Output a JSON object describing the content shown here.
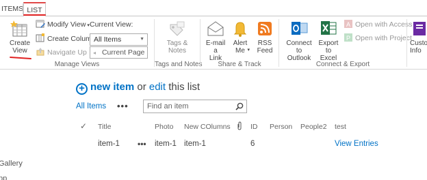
{
  "ribbon": {
    "tabs": {
      "items": "ITEMS",
      "list": "LIST"
    },
    "manage_views": {
      "create_view": "Create\nView",
      "modify_view": "Modify View",
      "create_column": "Create Column",
      "navigate_up": "Navigate Up",
      "current_view_label": "Current View:",
      "current_view_value": "All Items",
      "current_page": "Current Page",
      "group_label": "Manage Views"
    },
    "tags_notes": {
      "tags_notes": "Tags &\nNotes",
      "group_label": "Tags and Notes"
    },
    "share_track": {
      "email_link": "E-mail a\nLink",
      "alert_me": "Alert\nMe",
      "rss_feed": "RSS\nFeed",
      "group_label": "Share & Track"
    },
    "connect_export": {
      "connect_outlook": "Connect to\nOutlook",
      "export_excel": "Export to\nExcel",
      "open_access": "Open with Access",
      "open_project": "Open with Project",
      "group_label": "Connect & Export"
    },
    "customize": {
      "label": "Custo\nInfo"
    }
  },
  "page": {
    "new_item": "new item",
    "or": "or",
    "edit": "edit",
    "this_list": "this list",
    "all_items": "All Items",
    "more": "•••",
    "search_placeholder": "Find an item"
  },
  "table": {
    "check": "✓",
    "columns": [
      "Title",
      "Photo",
      "New COlumns",
      "ID",
      "Person",
      "People2",
      "test"
    ],
    "rows": [
      {
        "title": "item-1",
        "menu": "•••",
        "photo": "item-1",
        "new_columns": "item-1",
        "id": "6",
        "test": "View Entries"
      }
    ]
  },
  "left_nav": {
    "item1": "Gallery",
    "item2": "pp"
  },
  "colors": {
    "accent": "#0072c6",
    "highlight": "#e02020"
  }
}
